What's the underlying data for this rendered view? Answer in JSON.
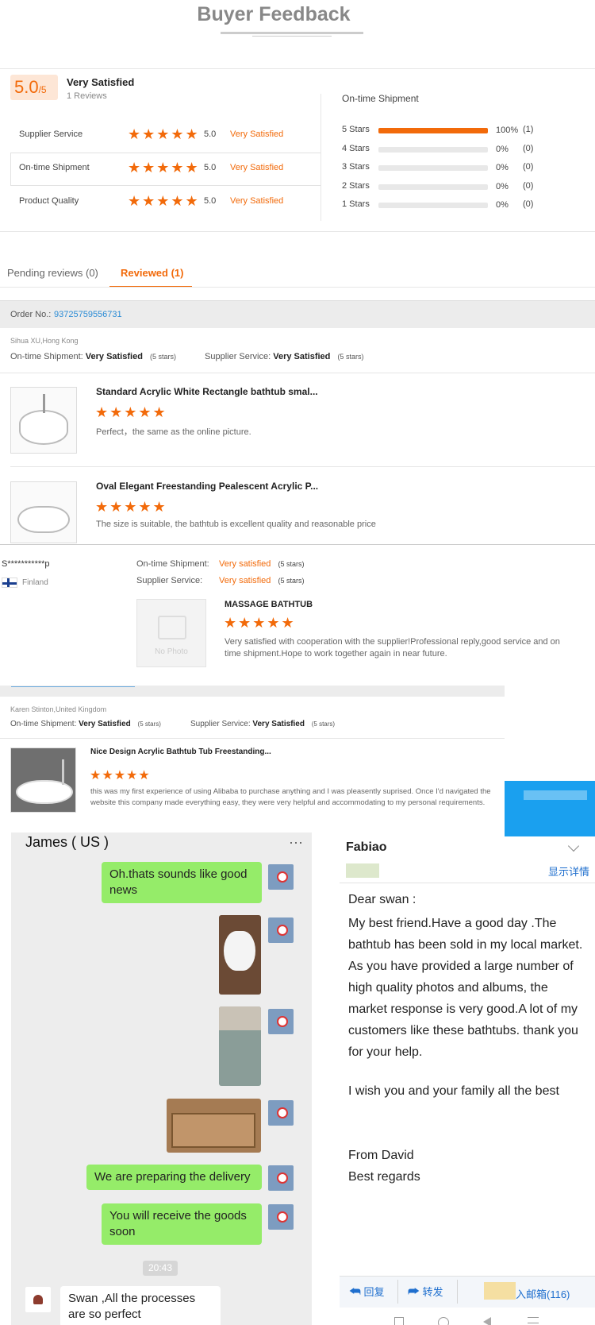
{
  "header": {
    "title": "Buyer Feedback"
  },
  "summary": {
    "score": "5.0",
    "score_denom": "/5",
    "label": "Very Satisfied",
    "reviews_count": "1 Reviews",
    "ratings": [
      {
        "name": "Supplier Service",
        "stars": "★★★★★",
        "value": "5.0",
        "text": "Very Satisfied"
      },
      {
        "name": "On-time Shipment",
        "stars": "★★★★★",
        "value": "5.0",
        "text": "Very Satisfied"
      },
      {
        "name": "Product Quality",
        "stars": "★★★★★",
        "value": "5.0",
        "text": "Very Satisfied"
      }
    ],
    "distribution_title": "On-time Shipment",
    "distribution": [
      {
        "label": "5 Stars",
        "fraction": 1.0,
        "percent": "100%",
        "count": "(1)"
      },
      {
        "label": "4 Stars",
        "fraction": 0.0,
        "percent": "0%",
        "count": "(0)"
      },
      {
        "label": "3 Stars",
        "fraction": 0.0,
        "percent": "0%",
        "count": "(0)"
      },
      {
        "label": "2 Stars",
        "fraction": 0.0,
        "percent": "0%",
        "count": "(0)"
      },
      {
        "label": "1 Stars",
        "fraction": 0.0,
        "percent": "0%",
        "count": "(0)"
      }
    ]
  },
  "tabs": [
    {
      "label": "Pending reviews (0)"
    },
    {
      "label": "Reviewed (1)"
    }
  ],
  "order1": {
    "order_label": "Order No.:",
    "order_number": "93725759556731",
    "buyer": "Sihua XU,Hong Kong",
    "shipment_label": "On-time Shipment:",
    "shipment_value": "Very Satisfied",
    "shipment_stars": "(5 stars)",
    "service_label": "Supplier Service:",
    "service_value": "Very Satisfied",
    "service_stars": "(5 stars)",
    "items": [
      {
        "title": "Standard Acrylic White Rectangle bathtub smal...",
        "stars": "★★★★★",
        "comment": "Perfect，the same as the online picture."
      },
      {
        "title": "Oval Elegant Freestanding Pealescent Acrylic P...",
        "stars": "★★★★★",
        "comment": "The size is suitable, the bathtub is excellent quality and reasonable price"
      }
    ]
  },
  "review2": {
    "buyer": "S***********p",
    "country": "Finland",
    "shipment_label": "On-time Shipment:",
    "shipment_value": "Very satisfied",
    "shipment_stars": "(5 stars)",
    "service_label": "Supplier Service:",
    "service_value": "Very satisfied",
    "service_stars": "(5 stars)",
    "no_photo": "No Photo",
    "product": "MASSAGE BATHTUB",
    "stars": "★★★★★",
    "comment": "Very satisfied with cooperation with the supplier!Professional reply,good service and on time shipment.Hope to work together again in near future."
  },
  "order3": {
    "buyer": "Karen Stinton,United Kingdom",
    "shipment_label": "On-time Shipment:",
    "shipment_value": "Very Satisfied",
    "shipment_stars": "(5 stars)",
    "service_label": "Supplier Service:",
    "service_value": "Very Satisfied",
    "service_stars": "(5 stars)",
    "title": "Nice Design Acrylic Bathtub Tub Freestanding...",
    "stars": "★★★★★",
    "comment": "this was my first experience of using Alibaba to purchase anything and I was pleasently suprised.  Once I'd navigated the website this company made everything easy, they were very helpful and accommodating to my personal requirements."
  },
  "chat": {
    "contact": "James ( US )",
    "more": "···",
    "messages": [
      "Oh.thats sounds like good news",
      "We are preparing the delivery",
      "You will receive the goods soon"
    ],
    "time": "20:43",
    "reply": "Swan ,All the processes are so perfect"
  },
  "email": {
    "sender": "Fabiao",
    "details_link": "显示详情",
    "greeting": "Dear swan :",
    "body": "My best friend.Have a good day .The bathtub has been sold in my local market. As you have provided a large number of high quality photos and albums, the market response is very good.A lot of my customers like these bathtubs. thank  you for your help.",
    "wish": "I wish you and your family all the best",
    "from": "From David",
    "regards": "Best regards",
    "reply_btn": "回复",
    "forward_btn": "转发",
    "inbox_btn": "入邮箱(116)"
  }
}
